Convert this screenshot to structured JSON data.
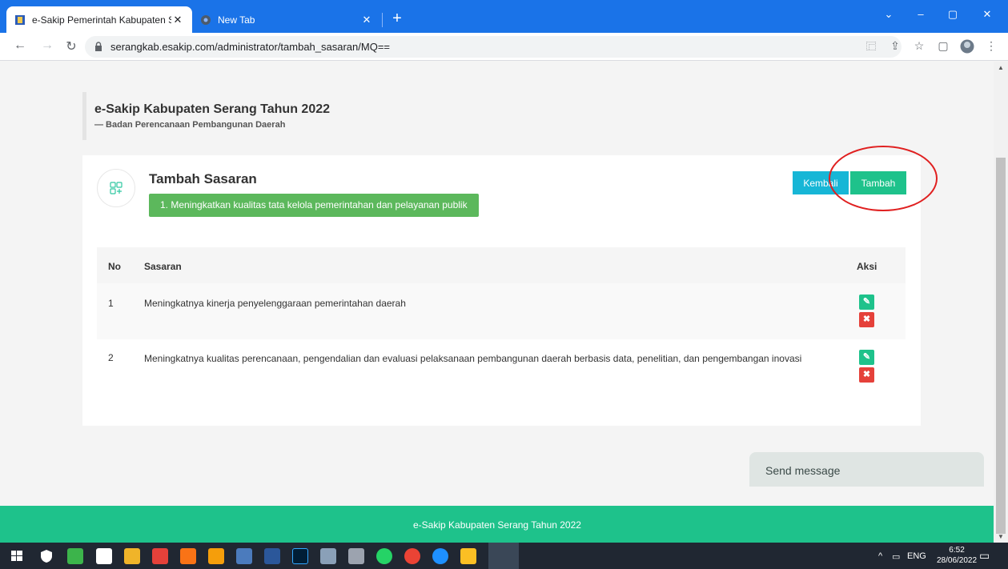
{
  "browser": {
    "tabs": [
      {
        "title": "e-Sakip Pemerintah Kabupaten S",
        "close": "✕"
      },
      {
        "title": "New Tab",
        "close": "✕"
      }
    ],
    "new_tab": "+",
    "url": "serangkab.esakip.com/administrator/tambah_sasaran/MQ==",
    "controls": {
      "minimize": "–",
      "maximize": "▢",
      "close": "✕",
      "dropdown": "⌄"
    }
  },
  "header": {
    "title": "e-Sakip Kabupaten Serang Tahun 2022",
    "subtitle": "— Badan Perencanaan Pembangunan Daerah"
  },
  "card": {
    "title": "Tambah Sasaran",
    "tujuan": "1. Meningkatkan kualitas tata kelola pemerintahan dan pelayanan publik",
    "buttons": {
      "kembali": "Kembali",
      "tambah": "Tambah"
    }
  },
  "table": {
    "headers": {
      "no": "No",
      "sasaran": "Sasaran",
      "aksi": "Aksi"
    },
    "rows": [
      {
        "no": "1",
        "sasaran": "Meningkatnya kinerja penyelenggaraan pemerintahan daerah"
      },
      {
        "no": "2",
        "sasaran": "Meningkatnya kualitas perencanaan, pengendalian dan evaluasi pelaksanaan pembangunan daerah berbasis data, penelitian, dan pengembangan inovasi"
      }
    ]
  },
  "footer": {
    "text": "e-Sakip Kabupaten Serang Tahun 2022"
  },
  "chat": {
    "send_message": "Send message"
  },
  "taskbar": {
    "lang": "ENG",
    "time": "6:52",
    "date": "28/06/2022"
  },
  "colors": {
    "accent": "#1ec28b",
    "info": "#17b6d6",
    "danger": "#e5413a",
    "chrome": "#1a73e8"
  }
}
